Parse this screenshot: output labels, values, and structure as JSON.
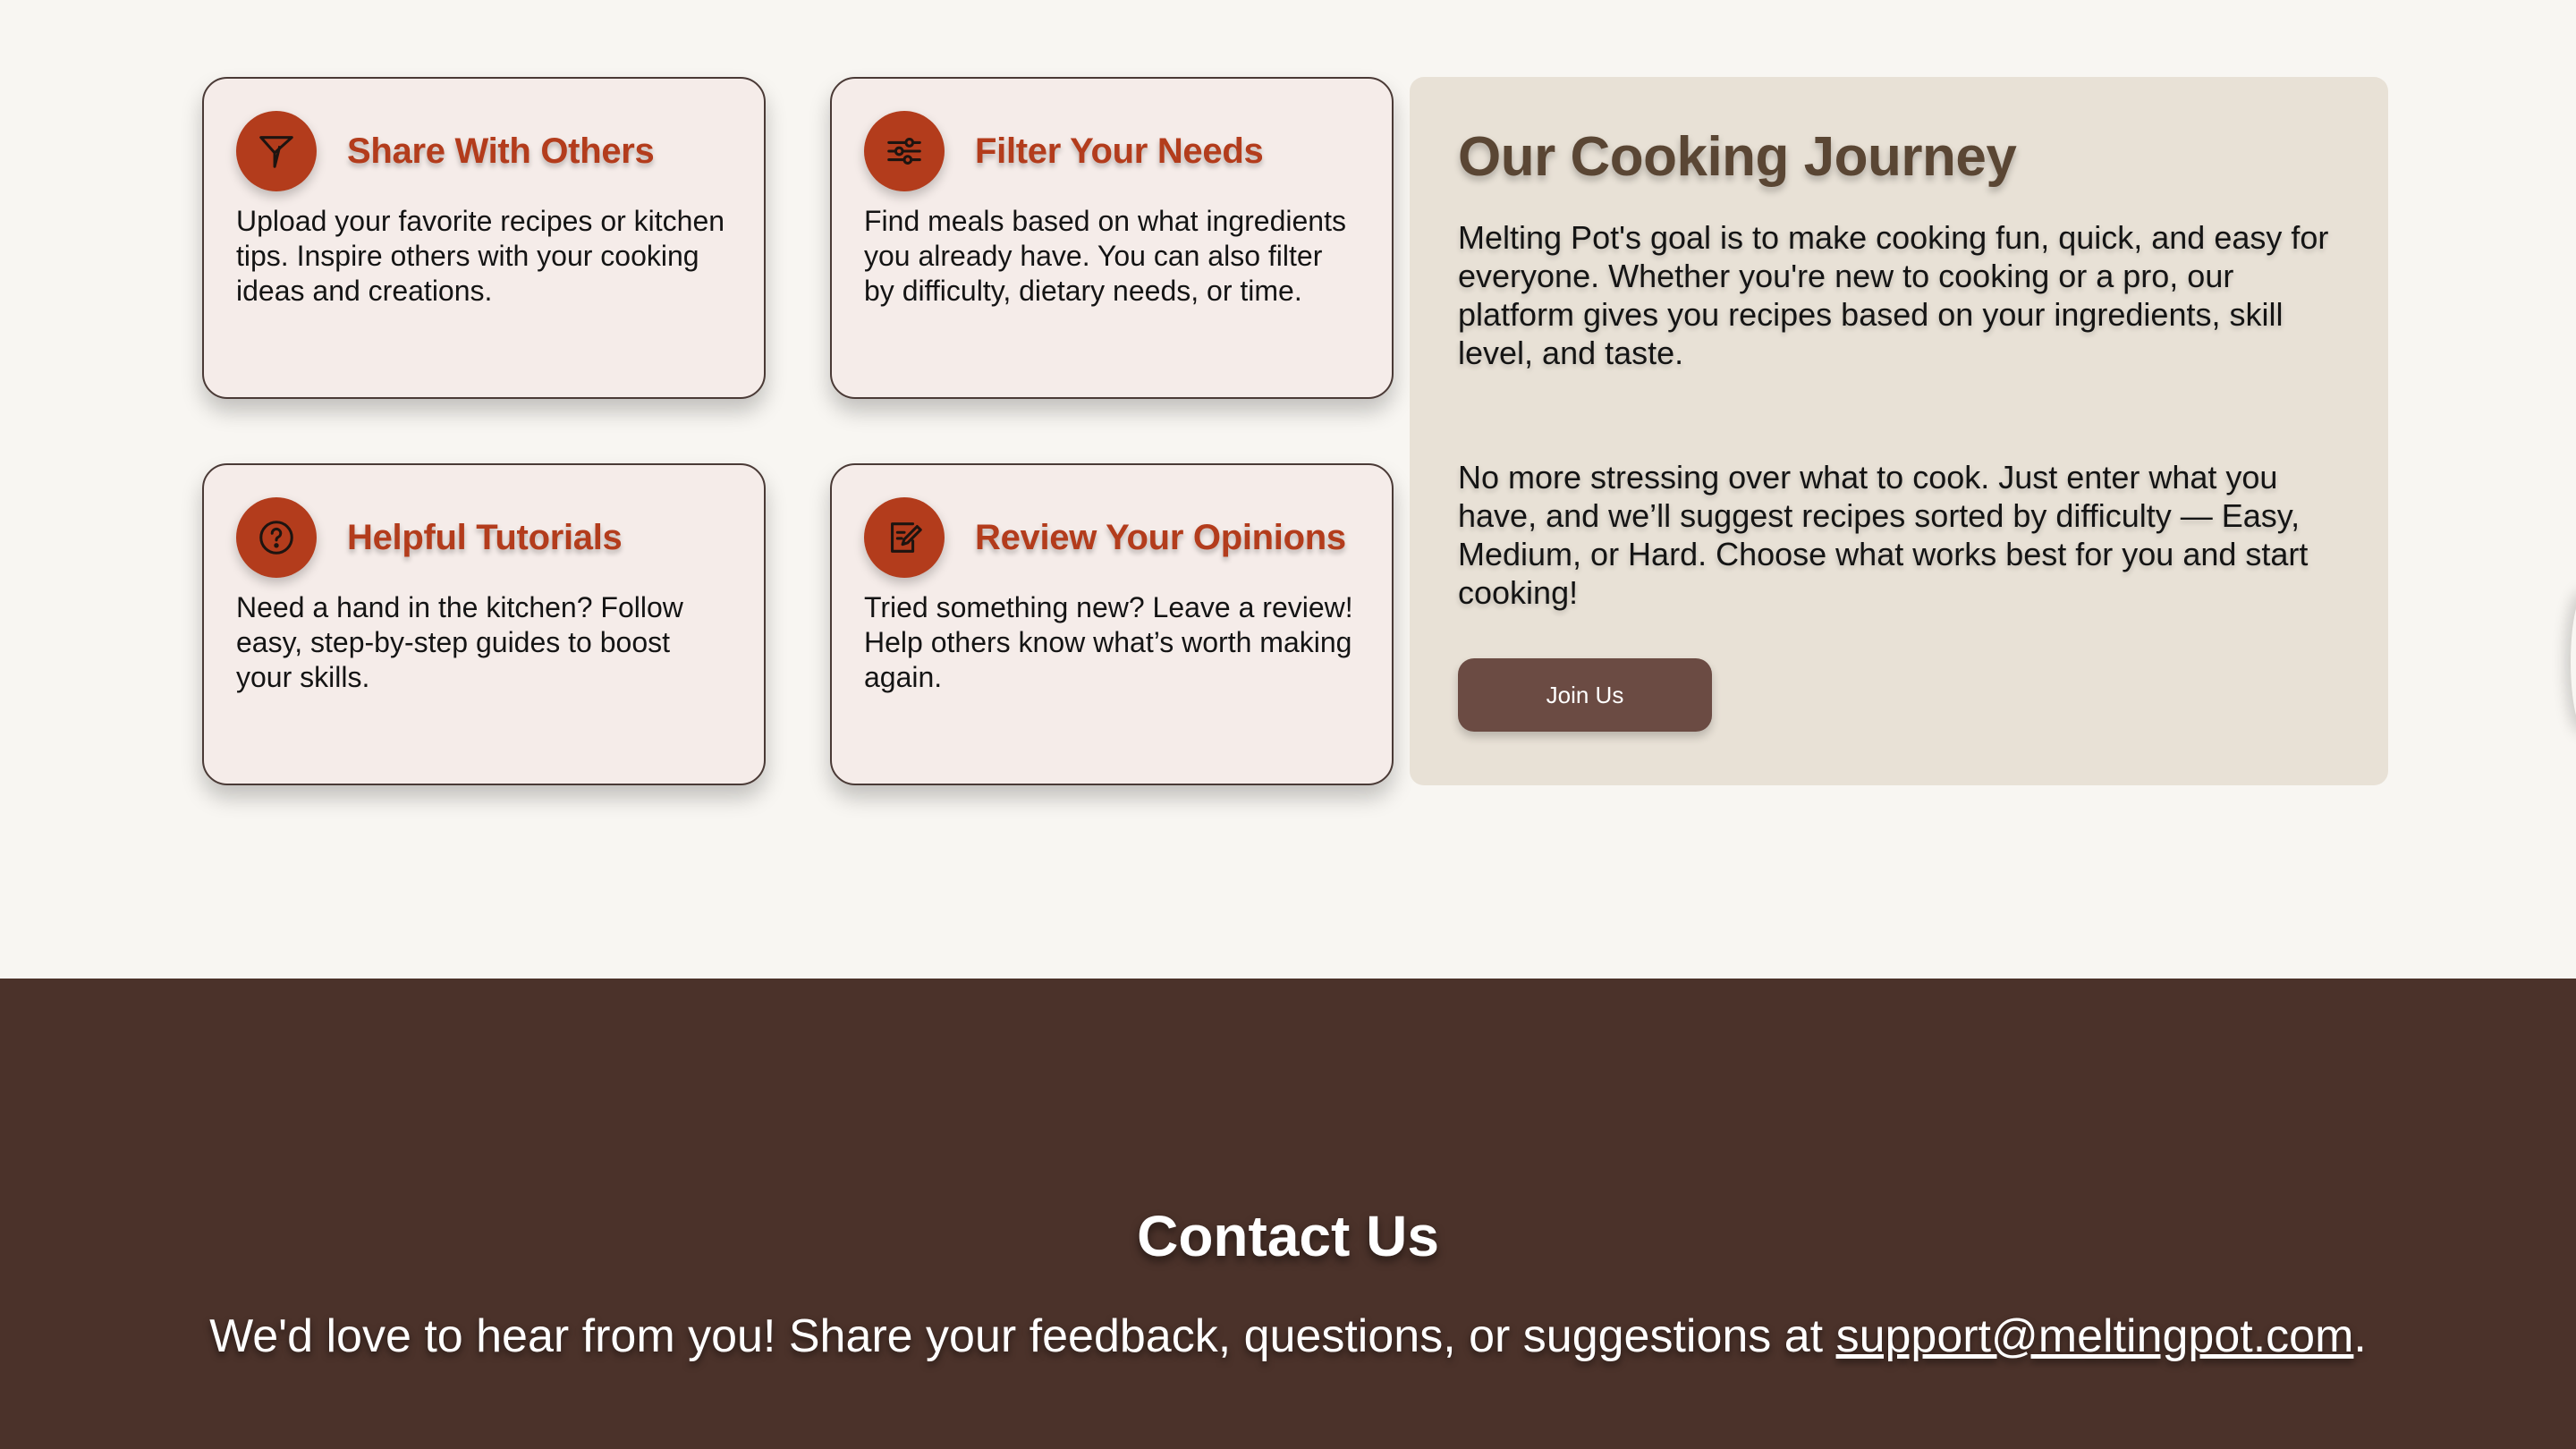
{
  "features": [
    {
      "title": "Share With Others",
      "icon": "paper-plane-icon",
      "text": "Upload your favorite recipes or kitchen tips. Inspire others with your cooking ideas and creations."
    },
    {
      "title": "Filter Your Needs",
      "icon": "sliders-icon",
      "text": "Find meals based on what ingredients you already have. You can also filter by difficulty, dietary needs, or time."
    },
    {
      "title": "Helpful Tutorials",
      "icon": "help-circle-icon",
      "text": "Need a hand in the kitchen? Follow easy, step-by-step guides to boost your skills."
    },
    {
      "title": "Review Your Opinions",
      "icon": "edit-note-icon",
      "text": "Tried something new? Leave a review! Help others know what’s worth making again."
    }
  ],
  "journey": {
    "title": "Our Cooking Journey",
    "paragraph1": "Melting Pot's goal is to make cooking fun, quick, and easy for everyone. Whether you're new to cooking or a pro, our platform gives you recipes based on your ingredients, skill level, and taste.",
    "paragraph2": "No more stressing over what to cook. Just enter what you have, and we’ll suggest recipes sorted by difficulty — Easy, Medium, or Hard. Choose what works best for you and start cooking!",
    "button_label": "Join Us"
  },
  "contact": {
    "title": "Contact Us",
    "text_before": "We'd love to hear from you! Share your feedback, questions, or suggestions at ",
    "email": "support@meltingpot.com",
    "text_after": "."
  },
  "colors": {
    "accent": "#b33c1c",
    "page_background": "#f8f6f2",
    "card_background": "#f5ece9",
    "journey_background": "#e8e1d6",
    "journey_title": "#5a4634",
    "button": "#6b4b43",
    "footer_background": "#4b322a"
  }
}
